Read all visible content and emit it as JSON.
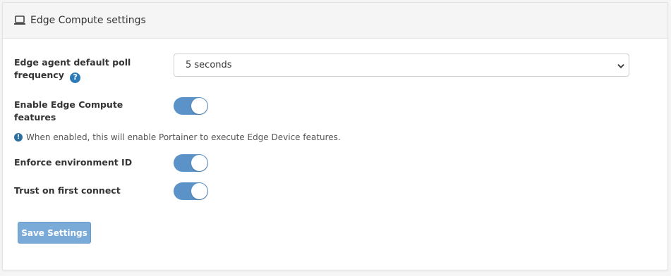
{
  "panel": {
    "title": "Edge Compute settings",
    "icon": "laptop-icon"
  },
  "poll_frequency": {
    "label_line1": "Edge agent default poll",
    "label_line2": "frequency",
    "help_icon": "question-circle-icon",
    "help_symbol": "?",
    "selected_value": "5 seconds"
  },
  "edge_compute": {
    "label_line1": "Enable Edge Compute",
    "label_line2": "features",
    "enabled": true
  },
  "info": {
    "icon": "exclamation-circle-icon",
    "icon_symbol": "!",
    "text": "When enabled, this will enable Portainer to execute Edge Device features."
  },
  "enforce_env_id": {
    "label": "Enforce environment ID",
    "enabled": true
  },
  "trust_first_connect": {
    "label": "Trust on first connect",
    "enabled": true
  },
  "save_button": {
    "label": "Save Settings"
  },
  "colors": {
    "toggle_on": "#5b93c9",
    "button": "#7aaad8",
    "help_icon": "#2d7ab8"
  }
}
